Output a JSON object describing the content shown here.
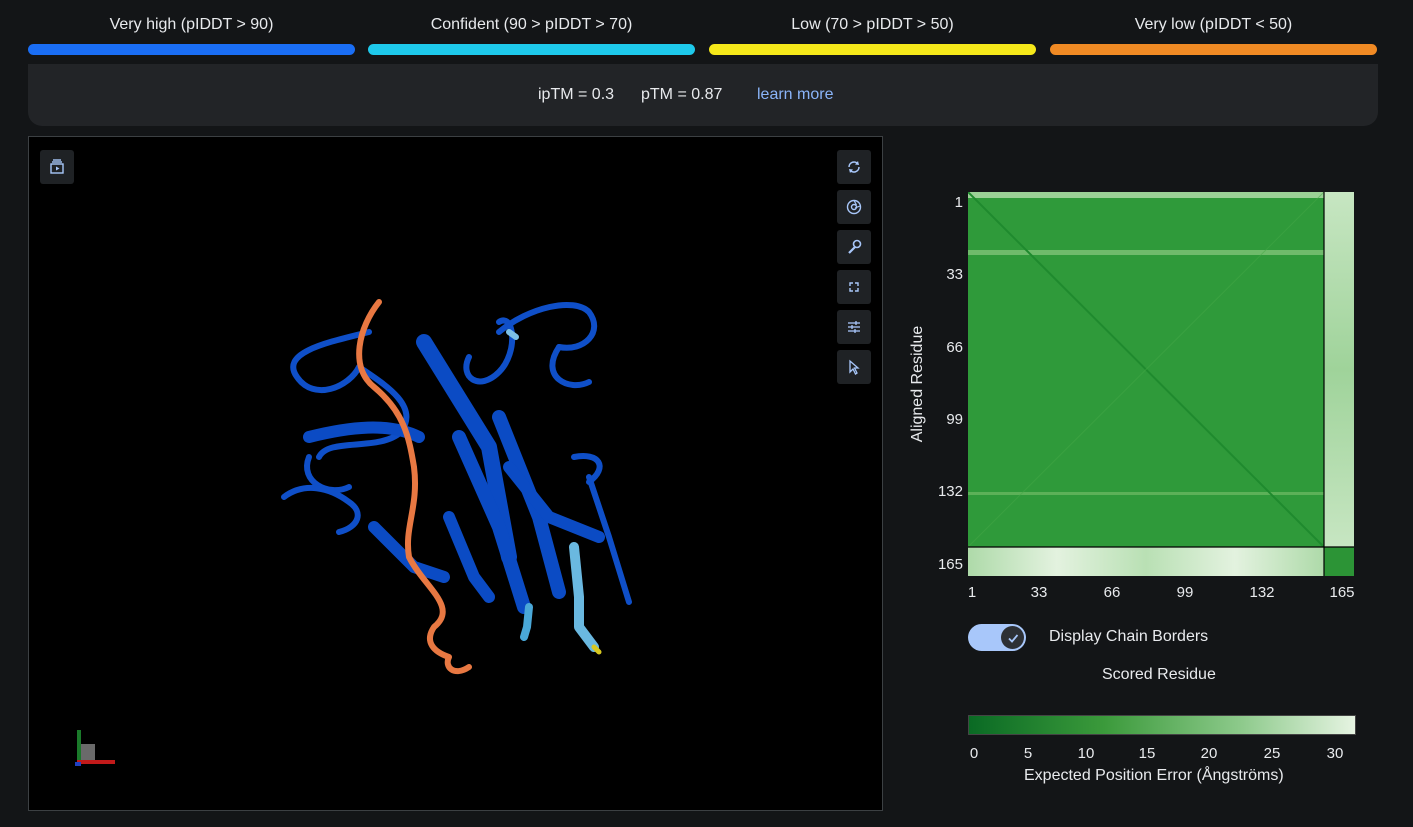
{
  "legend": {
    "items": [
      {
        "label": "Very high (pIDDT > 90)",
        "color": "#1a6ef5"
      },
      {
        "label": "Confident (90 > pIDDT > 70)",
        "color": "#1ec9eb"
      },
      {
        "label": "Low (70 > pIDDT > 50)",
        "color": "#f5e81a"
      },
      {
        "label": "Very low (pIDDT < 50)",
        "color": "#f08a24"
      }
    ]
  },
  "metrics": {
    "iptm": "ipTM = 0.3",
    "ptm": "pTM = 0.87",
    "learn_more": "learn more"
  },
  "viewer": {
    "tools": [
      "animation-icon",
      "rotate-icon",
      "camera-icon",
      "wrench-icon",
      "fullscreen-icon",
      "settings-icon",
      "cursor-icon"
    ]
  },
  "pae": {
    "y_title": "Aligned Residue",
    "y_ticks": [
      "1",
      "33",
      "66",
      "99",
      "132",
      "165"
    ],
    "x_ticks": [
      "1",
      "33",
      "66",
      "99",
      "132",
      "165"
    ],
    "toggle_label": "Display Chain Borders",
    "toggle_on": true,
    "x_title": "Scored Residue",
    "colorbar_ticks": [
      "0",
      "5",
      "10",
      "15",
      "20",
      "25",
      "30"
    ],
    "colorbar_label": "Expected Position Error (Ångströms)"
  }
}
